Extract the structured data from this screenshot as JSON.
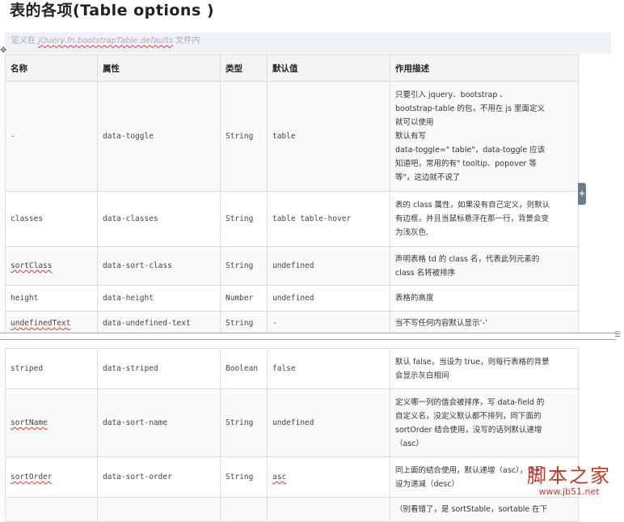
{
  "page_title": "表的各项(Table  options  )",
  "note": {
    "prefix": "定义在",
    "code": "jQuery.fn.bootstrapTable.defaults",
    "suffix": "文件内"
  },
  "table": {
    "headers": [
      "名称",
      "属性",
      "类型",
      "默认值",
      "作用描述"
    ],
    "rows": [
      {
        "name": "-",
        "attr": "data-toggle",
        "type": "String",
        "default": "table",
        "desc": [
          "只要引入 jquery、bootstrap 、",
          "bootstrap-table 的包，不用在 js 里面定义",
          "就可以使用",
          "默认有写",
          "data-toggle=\" table\"，data-toggle 应该",
          "知道吧，常用的有\" tooltip、popover 等",
          "等\"，这边就不说了"
        ]
      },
      {
        "name": "classes",
        "attr": "data-classes",
        "type": "String",
        "default": "table table-hover",
        "desc": [
          "表的 class 属性，如果没有自己定义，则默认",
          "有边框，并且当鼠标悬浮在那一行，背景会变",
          "为浅灰色."
        ]
      },
      {
        "name": "sortClass",
        "attr": "data-sort-class",
        "type": "String",
        "default": "undefined",
        "desc": [
          "声明表格 td 的 class 名，代表此列元素的",
          "class 名将被排序"
        ]
      },
      {
        "name": "height",
        "attr": "data-height",
        "type": "Number",
        "default": "undefined",
        "desc": [
          "表格的高度"
        ]
      },
      {
        "name": "undefinedText",
        "attr": "data-undefined-text",
        "type": "String",
        "default": "-",
        "desc": [
          "当不写任何内容默认显示’-’"
        ]
      },
      {
        "name": "striped",
        "attr": "data-striped",
        "type": "Boolean",
        "default": "false",
        "desc": [
          "默认 false，当设为 true，则每行表格的背景",
          "会显示灰白相间"
        ]
      },
      {
        "name": "sortName",
        "attr": "data-sort-name",
        "type": "String",
        "default": "undefined",
        "desc": [
          "定义哪一列的值会被排序，写 data-field 的",
          "自定义名，没定义默认都不排列，同下面的",
          "sortOrder 结合使用，没写的话列默认递增",
          "（asc）"
        ]
      },
      {
        "name": "sortOrder",
        "attr": "data-sort-order",
        "type": "String",
        "default": "asc",
        "desc": [
          "同上面的结合使用，默认递增（asc），也可",
          "设为递减（desc）"
        ]
      },
      {
        "name": "",
        "attr": "",
        "type": "",
        "default": "",
        "desc": [
          "（别看错了，是 sortStable，sortable 在下"
        ]
      }
    ]
  },
  "icons": {
    "move_handle": "move-cross-icon",
    "side_button": "plus-icon",
    "split_grip": "resize-grip-icon"
  },
  "colors": {
    "header_bg": "#f4f4f4",
    "stripe_bg": "#f9f9f9",
    "note_bg": "#eef1f5",
    "watermark": "#c0392b",
    "side_button": "#6f7b89"
  },
  "watermark": {
    "text": "脚本之家",
    "url": "www.jb51.net"
  }
}
